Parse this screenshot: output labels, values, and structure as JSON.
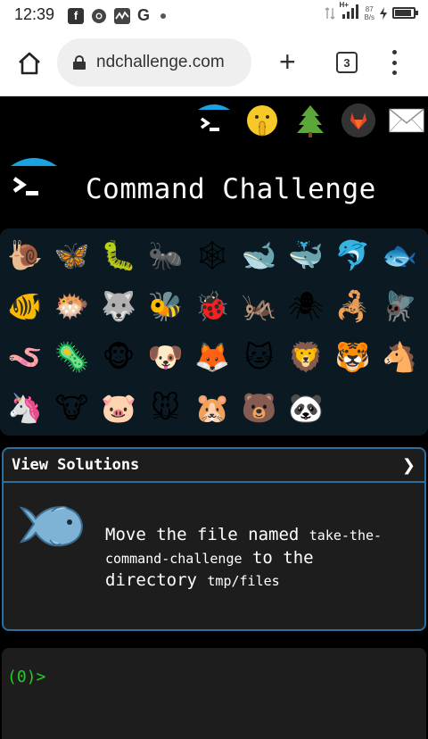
{
  "status_bar": {
    "time": "12:39",
    "app_icons": [
      "facebook-icon",
      "chrome-icon",
      "activity-icon",
      "google-icon",
      "dot-icon"
    ],
    "net_speed": "87",
    "net_unit": "B/s",
    "network_label": "H+"
  },
  "browser": {
    "url": "ndchallenge.com",
    "tab_count": "3"
  },
  "site": {
    "title": "Command Challenge",
    "top_links": [
      "terminal-logo-icon",
      "shushing-face-icon",
      "tree-icon",
      "gitlab-icon",
      "mail-icon"
    ]
  },
  "animals": [
    {
      "icon": "snail-icon",
      "glyph": "🐌"
    },
    {
      "icon": "butterfly-icon",
      "glyph": "🦋"
    },
    {
      "icon": "caterpillar-icon",
      "glyph": "🐛"
    },
    {
      "icon": "ant-icon",
      "glyph": "🐜"
    },
    {
      "icon": "spider-web-icon",
      "glyph": "🕸"
    },
    {
      "icon": "whale-icon",
      "glyph": "🐋"
    },
    {
      "icon": "spouting-whale-icon",
      "glyph": "🐳"
    },
    {
      "icon": "dolphin-icon",
      "glyph": "🐬"
    },
    {
      "icon": "fish-icon",
      "glyph": "🐟"
    },
    {
      "icon": "tropical-fish-icon",
      "glyph": "🐠"
    },
    {
      "icon": "blowfish-icon",
      "glyph": "🐡"
    },
    {
      "icon": "wolf-icon",
      "glyph": "🐺"
    },
    {
      "icon": "bee-icon",
      "glyph": "🐝"
    },
    {
      "icon": "ladybug-icon",
      "glyph": "🐞"
    },
    {
      "icon": "cricket-icon",
      "glyph": "🦗"
    },
    {
      "icon": "spider-icon",
      "glyph": "🕷"
    },
    {
      "icon": "scorpion-icon",
      "glyph": "🦂"
    },
    {
      "icon": "fly-icon",
      "glyph": "🪰"
    },
    {
      "icon": "worm-icon",
      "glyph": "🪱"
    },
    {
      "icon": "microbe-icon",
      "glyph": "🦠"
    },
    {
      "icon": "monkey-icon",
      "glyph": "🐵"
    },
    {
      "icon": "dog-icon",
      "glyph": "🐶"
    },
    {
      "icon": "fox-icon",
      "glyph": "🦊"
    },
    {
      "icon": "cat-icon",
      "glyph": "🐱"
    },
    {
      "icon": "lion-icon",
      "glyph": "🦁"
    },
    {
      "icon": "tiger-icon",
      "glyph": "🐯"
    },
    {
      "icon": "horse-icon",
      "glyph": "🐴"
    },
    {
      "icon": "unicorn-icon",
      "glyph": "🦄"
    },
    {
      "icon": "cow-icon",
      "glyph": "🐮"
    },
    {
      "icon": "pig-icon",
      "glyph": "🐷"
    },
    {
      "icon": "mouse-icon",
      "glyph": "🐭"
    },
    {
      "icon": "hamster-icon",
      "glyph": "🐹"
    },
    {
      "icon": "bear-icon",
      "glyph": "🐻"
    },
    {
      "icon": "panda-icon",
      "glyph": "🐼"
    }
  ],
  "challenge": {
    "view_solutions_label": "View Solutions",
    "chevron": "❯",
    "task_part1": "Move the file named ",
    "task_code1": "take-the-command-challenge",
    "task_part2": " to the directory ",
    "task_code2": "tmp/files",
    "illustration": "fish-icon"
  },
  "terminal": {
    "prompt": "(0)>"
  },
  "colors": {
    "accent_blue": "#1aa3e0",
    "border_blue": "#2b6f9c",
    "prompt_green": "#1fd11f",
    "grid_background": "#0b1a22"
  }
}
